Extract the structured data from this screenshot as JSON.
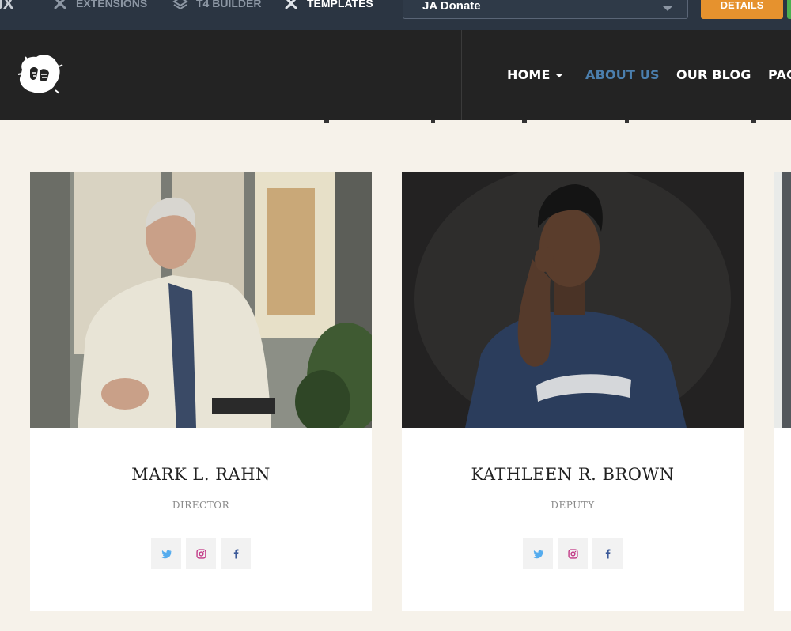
{
  "topbar": {
    "brand": "JX",
    "links": [
      {
        "label": "EXTENSIONS",
        "icon": "joomla-icon"
      },
      {
        "label": "T4 BUILDER",
        "icon": "layers-icon"
      },
      {
        "label": "TEMPLATES",
        "icon": "joomla-icon"
      }
    ],
    "select_value": "JA Donate",
    "details_label": "DETAILS"
  },
  "header": {
    "nav": [
      {
        "label": "HOME",
        "has_dropdown": true,
        "active": false
      },
      {
        "label": "ABOUT US",
        "active": true
      },
      {
        "label": "OUR BLOG",
        "active": false
      },
      {
        "label": "PAG",
        "active": false
      }
    ],
    "accent_color": "#4b7fae"
  },
  "team": [
    {
      "name": "MARK L. RAHN",
      "role": "DIRECTOR",
      "socials": [
        "twitter-icon",
        "instagram-icon",
        "facebook-icon"
      ]
    },
    {
      "name": "KATHLEEN R. BROWN",
      "role": "DEPUTY",
      "socials": [
        "twitter-icon",
        "instagram-icon",
        "facebook-icon"
      ]
    }
  ],
  "colors": {
    "topbar": "#2b3542",
    "header": "#232323",
    "details_button": "#e6922e",
    "twitter": "#55acee",
    "instagram": "#c13584",
    "facebook": "#3b5998"
  }
}
